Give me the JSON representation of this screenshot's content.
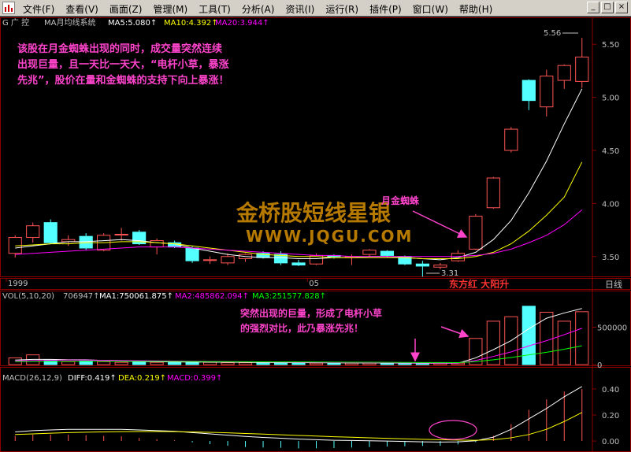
{
  "app": {
    "menus": [
      "文件(F)",
      "查看(V)",
      "画面(Z)",
      "管理(M)",
      "工具(T)",
      "分析(A)",
      "资讯(I)",
      "运行(R)",
      "插件(P)",
      "窗口(W)",
      "帮助(H)"
    ],
    "window_buttons": [
      "_",
      "□",
      "×"
    ]
  },
  "colors": {
    "up": "#ff5454",
    "down": "#54ffff",
    "ma5": "#ffffff",
    "ma10": "#ffff00",
    "ma20": "#ff00ff",
    "grid": "#8b0000",
    "annotation": "#ff44cc",
    "watermark": "#e8a000"
  },
  "header": {
    "prefix": "G 广  控",
    "system": "MA月均线系统",
    "ma5": "MA5:5.080↑",
    "ma10": "MA10:4.392↑",
    "ma20": "MA20:3.944↑"
  },
  "vol_header": {
    "title": "VOL(5,10,20)",
    "value": "706947↑",
    "ma1": "MA1:750061.875↑",
    "ma2": "MA2:485862.094↑",
    "ma3": "MA3:251577.828↑"
  },
  "macd_header": {
    "title": "MACD(26,12,9)",
    "diff": "DIFF:0.419↑",
    "dea": "DEA:0.219↑",
    "macd": "MACD:0.399↑"
  },
  "annotations": {
    "main_text": [
      "该股在月金蜘蛛出现的同时，成交量突然连续",
      "出现巨量，且一天比一天大，“电杆小草，暴涨",
      "先兆”，股价在量和金蜘蛛的支持下向上暴涨！"
    ],
    "spider_label": "月金蜘蛛",
    "vol_text": [
      "突然出现的巨量，形成了电杆小草",
      "的强烈对比，此乃暴涨先兆！"
    ],
    "bottom_label": "东方红  大阳升",
    "period": "日线",
    "watermark_cn": "金桥股短线星银",
    "watermark_url": "WWW.JQGU.COM",
    "high_label": "5.56",
    "low_label": "3.31"
  },
  "chart_data": [
    {
      "type": "candlestick",
      "ylim": [
        3.35,
        5.65
      ],
      "yticks": [
        "5.50",
        "5.00",
        "4.50",
        "4.00",
        "3.50"
      ],
      "x_labels": [
        {
          "index": 0,
          "label": "1999"
        },
        {
          "index": 17,
          "label": "05"
        }
      ],
      "candles": [
        {
          "o": 3.53,
          "h": 3.7,
          "l": 3.49,
          "c": 3.68
        },
        {
          "o": 3.68,
          "h": 3.82,
          "l": 3.63,
          "c": 3.79
        },
        {
          "o": 3.82,
          "h": 3.85,
          "l": 3.62,
          "c": 3.63
        },
        {
          "o": 3.64,
          "h": 3.7,
          "l": 3.6,
          "c": 3.66
        },
        {
          "o": 3.69,
          "h": 3.72,
          "l": 3.56,
          "c": 3.58
        },
        {
          "o": 3.56,
          "h": 3.72,
          "l": 3.55,
          "c": 3.7
        },
        {
          "o": 3.71,
          "h": 3.77,
          "l": 3.65,
          "c": 3.71
        },
        {
          "o": 3.73,
          "h": 3.75,
          "l": 3.61,
          "c": 3.62
        },
        {
          "o": 3.59,
          "h": 3.67,
          "l": 3.52,
          "c": 3.65
        },
        {
          "o": 3.63,
          "h": 3.65,
          "l": 3.58,
          "c": 3.59
        },
        {
          "o": 3.58,
          "h": 3.6,
          "l": 3.44,
          "c": 3.46
        },
        {
          "o": 3.47,
          "h": 3.5,
          "l": 3.43,
          "c": 3.47
        },
        {
          "o": 3.44,
          "h": 3.53,
          "l": 3.42,
          "c": 3.5
        },
        {
          "o": 3.48,
          "h": 3.53,
          "l": 3.45,
          "c": 3.52
        },
        {
          "o": 3.53,
          "h": 3.55,
          "l": 3.48,
          "c": 3.49
        },
        {
          "o": 3.52,
          "h": 3.55,
          "l": 3.42,
          "c": 3.44
        },
        {
          "o": 3.44,
          "h": 3.47,
          "l": 3.41,
          "c": 3.42
        },
        {
          "o": 3.43,
          "h": 3.53,
          "l": 3.42,
          "c": 3.51
        },
        {
          "o": 3.51,
          "h": 3.52,
          "l": 3.48,
          "c": 3.5
        },
        {
          "o": 3.49,
          "h": 3.52,
          "l": 3.42,
          "c": 3.5
        },
        {
          "o": 3.52,
          "h": 3.57,
          "l": 3.5,
          "c": 3.56
        },
        {
          "o": 3.55,
          "h": 3.56,
          "l": 3.49,
          "c": 3.51
        },
        {
          "o": 3.5,
          "h": 3.51,
          "l": 3.42,
          "c": 3.43
        },
        {
          "o": 3.43,
          "h": 3.46,
          "l": 3.31,
          "c": 3.41
        },
        {
          "o": 3.4,
          "h": 3.44,
          "l": 3.38,
          "c": 3.42
        },
        {
          "o": 3.46,
          "h": 3.56,
          "l": 3.45,
          "c": 3.53
        },
        {
          "o": 3.57,
          "h": 3.9,
          "l": 3.56,
          "c": 3.88
        },
        {
          "o": 3.96,
          "h": 4.25,
          "l": 3.95,
          "c": 4.24
        },
        {
          "o": 4.5,
          "h": 4.72,
          "l": 4.48,
          "c": 4.7
        },
        {
          "o": 5.16,
          "h": 5.17,
          "l": 4.88,
          "c": 4.97
        },
        {
          "o": 4.91,
          "h": 5.26,
          "l": 4.82,
          "c": 5.2
        },
        {
          "o": 5.16,
          "h": 5.31,
          "l": 5.08,
          "c": 5.3
        },
        {
          "o": 5.15,
          "h": 5.56,
          "l": 5.09,
          "c": 5.38
        }
      ],
      "ma5": [
        3.58,
        3.6,
        3.62,
        3.64,
        3.64,
        3.65,
        3.66,
        3.65,
        3.63,
        3.62,
        3.58,
        3.55,
        3.52,
        3.5,
        3.49,
        3.49,
        3.48,
        3.48,
        3.49,
        3.49,
        3.5,
        3.5,
        3.49,
        3.48,
        3.47,
        3.49,
        3.54,
        3.66,
        3.84,
        4.1,
        4.4,
        4.75,
        5.08
      ],
      "ma10": [
        3.6,
        3.61,
        3.62,
        3.62,
        3.63,
        3.63,
        3.64,
        3.64,
        3.63,
        3.62,
        3.6,
        3.58,
        3.56,
        3.54,
        3.52,
        3.51,
        3.5,
        3.5,
        3.49,
        3.49,
        3.49,
        3.49,
        3.49,
        3.48,
        3.48,
        3.48,
        3.5,
        3.54,
        3.62,
        3.74,
        3.89,
        4.06,
        4.39
      ],
      "ma20": [
        3.52,
        3.53,
        3.54,
        3.55,
        3.56,
        3.57,
        3.58,
        3.59,
        3.59,
        3.59,
        3.58,
        3.57,
        3.56,
        3.55,
        3.54,
        3.53,
        3.52,
        3.51,
        3.51,
        3.5,
        3.5,
        3.5,
        3.5,
        3.5,
        3.5,
        3.5,
        3.51,
        3.53,
        3.57,
        3.63,
        3.7,
        3.8,
        3.94
      ]
    },
    {
      "type": "bar",
      "title": "VOL(5,10,20)",
      "ylim": [
        0,
        800000
      ],
      "yticks": [
        "500000",
        "0"
      ],
      "volumes": [
        90000,
        130000,
        60000,
        40000,
        50000,
        40000,
        30000,
        40000,
        30000,
        30000,
        35000,
        30000,
        25000,
        25000,
        20000,
        30000,
        25000,
        20000,
        20000,
        20000,
        20000,
        20000,
        15000,
        15000,
        20000,
        20000,
        350000,
        580000,
        640000,
        780000,
        700000,
        580000,
        706947
      ],
      "ma1": [
        60000,
        70000,
        70000,
        65000,
        65000,
        55000,
        45000,
        40000,
        38000,
        36000,
        34000,
        33000,
        32000,
        30000,
        28000,
        27000,
        26000,
        25000,
        24000,
        23000,
        22000,
        21000,
        20000,
        19000,
        19000,
        18000,
        90000,
        200000,
        320000,
        480000,
        620000,
        690000,
        750061
      ],
      "ma2": [
        50000,
        55000,
        58000,
        60000,
        60000,
        58000,
        55000,
        52000,
        50000,
        48000,
        45000,
        42000,
        40000,
        38000,
        36000,
        34000,
        32000,
        30000,
        28000,
        27000,
        26000,
        25000,
        24000,
        23000,
        22000,
        21000,
        55000,
        110000,
        170000,
        250000,
        320000,
        400000,
        485862
      ],
      "ma3": [
        40000,
        42000,
        44000,
        45000,
        46000,
        46000,
        45000,
        44000,
        43000,
        42000,
        41000,
        40000,
        39000,
        38000,
        37000,
        36000,
        35000,
        34000,
        33000,
        32000,
        31000,
        30000,
        29000,
        28000,
        27000,
        26000,
        40000,
        65000,
        95000,
        130000,
        165000,
        205000,
        251577
      ]
    },
    {
      "type": "macd",
      "title": "MACD(26,12,9)",
      "ylim": [
        -0.06,
        0.46
      ],
      "yticks": [
        "0.40",
        "0.20",
        "0.00"
      ],
      "diff": [
        0.07,
        0.08,
        0.085,
        0.09,
        0.09,
        0.09,
        0.09,
        0.085,
        0.08,
        0.075,
        0.065,
        0.055,
        0.045,
        0.035,
        0.028,
        0.022,
        0.015,
        0.01,
        0.006,
        0.004,
        0.002,
        0.0,
        -0.003,
        -0.006,
        -0.008,
        -0.006,
        0.002,
        0.03,
        0.09,
        0.17,
        0.25,
        0.34,
        0.419
      ],
      "dea": [
        0.05,
        0.055,
        0.06,
        0.065,
        0.068,
        0.07,
        0.072,
        0.073,
        0.073,
        0.072,
        0.07,
        0.067,
        0.063,
        0.058,
        0.053,
        0.048,
        0.043,
        0.038,
        0.033,
        0.029,
        0.025,
        0.021,
        0.017,
        0.013,
        0.01,
        0.007,
        0.006,
        0.01,
        0.025,
        0.05,
        0.09,
        0.15,
        0.219
      ],
      "macd": [
        0.04,
        0.05,
        0.05,
        0.05,
        0.045,
        0.04,
        0.036,
        0.024,
        0.014,
        0.006,
        -0.01,
        -0.024,
        -0.036,
        -0.046,
        -0.05,
        -0.052,
        -0.056,
        -0.056,
        -0.054,
        -0.05,
        -0.046,
        -0.042,
        -0.04,
        -0.038,
        -0.036,
        -0.026,
        -0.008,
        0.04,
        0.13,
        0.24,
        0.32,
        0.38,
        0.399
      ]
    }
  ]
}
